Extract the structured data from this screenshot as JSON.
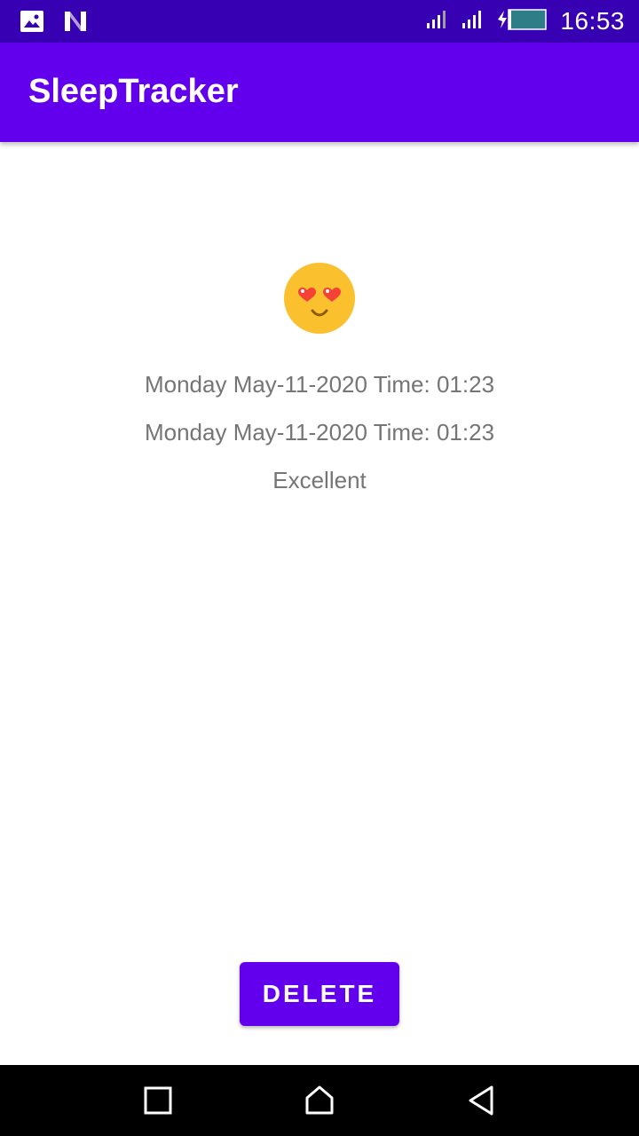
{
  "status_bar": {
    "time": "16:53",
    "icons": [
      "image-icon",
      "n-logo-icon",
      "signal-icon",
      "signal-icon",
      "battery-charging-icon"
    ]
  },
  "app_bar": {
    "title": "SleepTracker"
  },
  "detail": {
    "quality_icon": "heart-eyes-emoji-icon",
    "start_time": "Monday May-11-2020 Time: 01:23",
    "end_time": "Monday May-11-2020 Time: 01:23",
    "quality_label": "Excellent"
  },
  "actions": {
    "delete_label": "DELETE"
  },
  "nav_bar": {
    "icons": [
      "recent-apps-icon",
      "home-icon",
      "back-icon"
    ]
  },
  "colors": {
    "status_bar": "#3700b3",
    "primary": "#6200ee",
    "text_secondary": "#757575",
    "emoji_face": "#fbc02d",
    "heart": "#f44336"
  }
}
